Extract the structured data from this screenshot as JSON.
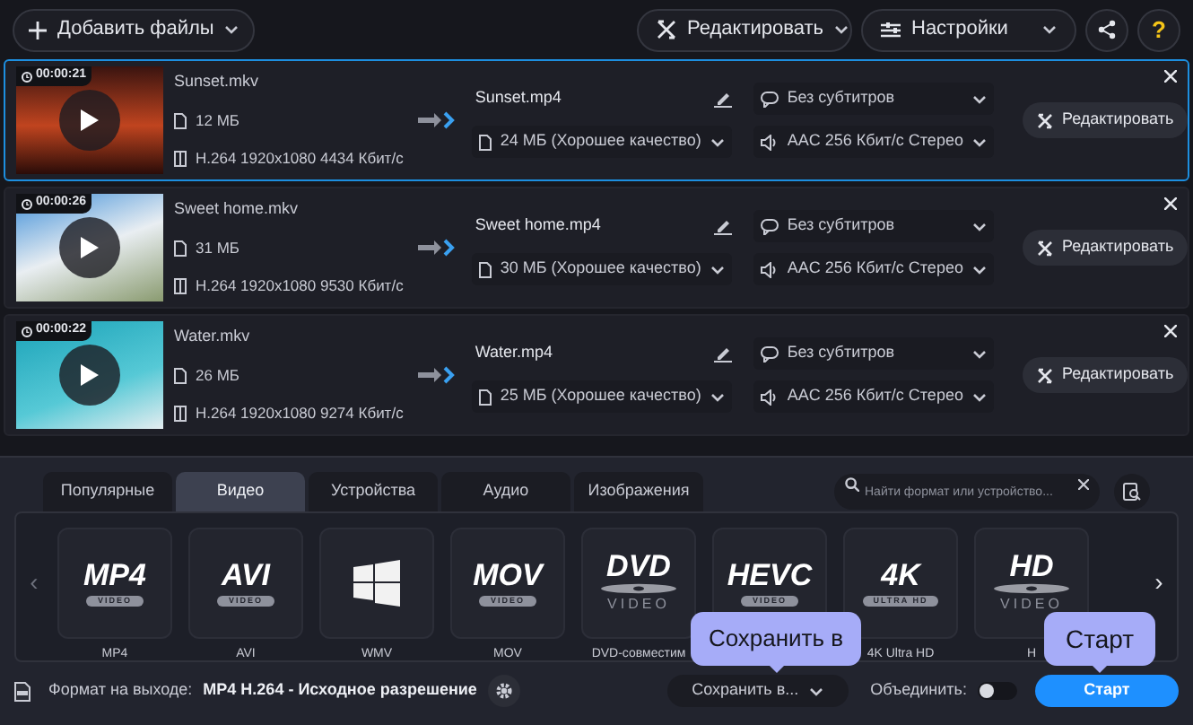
{
  "toolbar": {
    "add_files": "Добавить файлы",
    "edit": "Редактировать",
    "settings": "Настройки",
    "help": "?"
  },
  "files": [
    {
      "selected": true,
      "duration": "00:00:21",
      "name": "Sunset.mkv",
      "size": "12 МБ",
      "codec": "H.264 1920x1080 4434 Кбит/с",
      "output_name": "Sunset.mp4",
      "output_size": "24 МБ (Хорошее качество)",
      "subtitles": "Без субтитров",
      "audio": "AAC 256 Кбит/с Стерео",
      "edit": "Редактировать"
    },
    {
      "selected": false,
      "duration": "00:00:26",
      "name": "Sweet home.mkv",
      "size": "31 МБ",
      "codec": "H.264 1920x1080 9530 Кбит/с",
      "output_name": "Sweet home.mp4",
      "output_size": "30 МБ (Хорошее качество)",
      "subtitles": "Без субтитров",
      "audio": "AAC 256 Кбит/с Стерео",
      "edit": "Редактировать"
    },
    {
      "selected": false,
      "duration": "00:00:22",
      "name": "Water.mkv",
      "size": "26 МБ",
      "codec": "H.264 1920x1080 9274 Кбит/с",
      "output_name": "Water.mp4",
      "output_size": "25 МБ (Хорошее качество)",
      "subtitles": "Без субтитров",
      "audio": "AAC 256 Кбит/с Стерео",
      "edit": "Редактировать"
    }
  ],
  "tabs": [
    {
      "label": "Популярные",
      "selected": false
    },
    {
      "label": "Видео",
      "selected": true
    },
    {
      "label": "Устройства",
      "selected": false
    },
    {
      "label": "Аудио",
      "selected": false
    },
    {
      "label": "Изображения",
      "selected": false
    }
  ],
  "search": {
    "placeholder": "Найти формат или устройство..."
  },
  "carousel": {
    "previous": "‹",
    "next": "›"
  },
  "formats": [
    {
      "kind": "text",
      "logo": "MP4",
      "sub": "VIDEO",
      "label": "MP4"
    },
    {
      "kind": "text",
      "logo": "AVI",
      "sub": "VIDEO",
      "label": "AVI"
    },
    {
      "kind": "windows",
      "label": "WMV"
    },
    {
      "kind": "text",
      "logo": "MOV",
      "sub": "VIDEO",
      "label": "MOV"
    },
    {
      "kind": "disc",
      "logo": "DVD",
      "sub": "VIDEO",
      "label": "DVD-совместим"
    },
    {
      "kind": "text",
      "logo": "HEVC",
      "sub": "VIDEO"
    },
    {
      "kind": "text",
      "logo": "4K",
      "sub": "ULTRA HD",
      "label": "4K Ultra HD"
    },
    {
      "kind": "disc",
      "logo": "HD",
      "sub": "VIDEO",
      "label": "H"
    }
  ],
  "footer": {
    "output_label": "Формат на выходе:",
    "output_value": "MP4 H.264 - Исходное разрешение",
    "save_to": "Сохранить в...",
    "merge_label": "Объединить:",
    "merge_on": false,
    "start": "Старт"
  },
  "tooltips": [
    {
      "text": "Сохранить в"
    },
    {
      "text": "Старт"
    }
  ]
}
